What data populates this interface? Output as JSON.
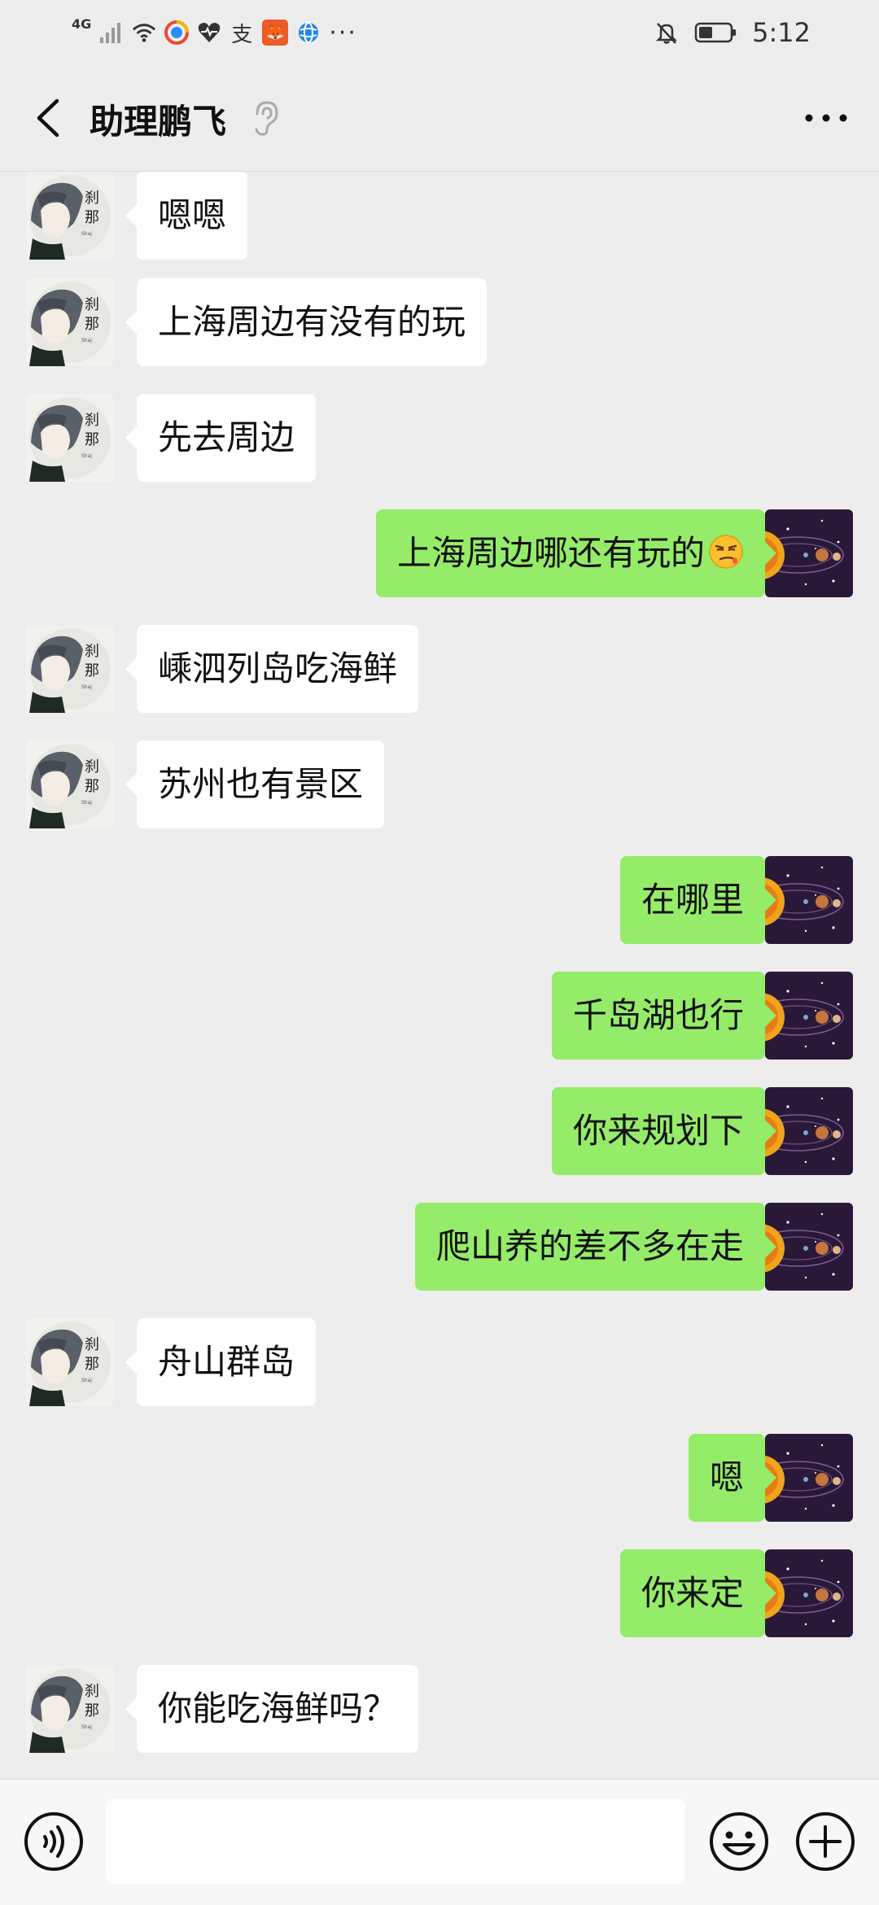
{
  "status_bar": {
    "network": "4G",
    "time": "5:12",
    "more": "···",
    "alipay_glyph": "支",
    "app_tile_glyph": "🦊"
  },
  "header": {
    "title": "助理鹏飞",
    "icons": [
      "back-arrow-icon",
      "ear-icon",
      "more-icon"
    ]
  },
  "messages": [
    {
      "side": "left",
      "text": "嗯嗯"
    },
    {
      "side": "left",
      "text": "上海周边有没有的玩"
    },
    {
      "side": "left",
      "text": "先去周边"
    },
    {
      "side": "right",
      "text": "上海周边哪还有玩的",
      "emoji": "smirk-face"
    },
    {
      "side": "left",
      "text": "嵊泗列岛吃海鲜"
    },
    {
      "side": "left",
      "text": "苏州也有景区"
    },
    {
      "side": "right",
      "text": "在哪里"
    },
    {
      "side": "right",
      "text": "千岛湖也行"
    },
    {
      "side": "right",
      "text": "你来规划下"
    },
    {
      "side": "right",
      "text": "爬山养的差不多在走"
    },
    {
      "side": "left",
      "text": "舟山群岛"
    },
    {
      "side": "right",
      "text": "嗯"
    },
    {
      "side": "right",
      "text": "你来定"
    },
    {
      "side": "left",
      "text": "你能吃海鲜吗？"
    }
  ],
  "input_bar": {
    "value": "",
    "icons": [
      "voice-icon",
      "emoji-icon",
      "plus-icon"
    ]
  },
  "colors": {
    "background": "#ededed",
    "sent_bubble": "#95ec69",
    "received_bubble": "#ffffff"
  }
}
